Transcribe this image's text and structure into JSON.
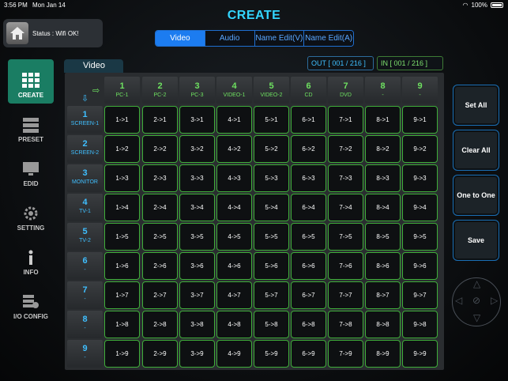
{
  "statusbar": {
    "time": "3:56 PM",
    "date": "Mon Jan 14",
    "battery": "100%"
  },
  "title": "CREATE",
  "status_panel": {
    "text": "Status : Wifi OK!"
  },
  "tabs": [
    "Video",
    "Audio",
    "Name Edit(V)",
    "Name Edit(A)"
  ],
  "sidebar": [
    {
      "label": "CREATE",
      "icon": "grid-icon"
    },
    {
      "label": "PRESET",
      "icon": "preset-icon"
    },
    {
      "label": "EDID",
      "icon": "monitor-icon"
    },
    {
      "label": "SETTING",
      "icon": "gear-icon"
    },
    {
      "label": "INFO",
      "icon": "info-icon"
    },
    {
      "label": "I/O CONFIG",
      "icon": "io-config-icon"
    }
  ],
  "section_label": "Video",
  "out_counter": "OUT [ 001 / 216 ]",
  "in_counter": "IN [ 001 / 216 ]",
  "columns": [
    {
      "num": "1",
      "name": "PC-1"
    },
    {
      "num": "2",
      "name": "PC-2"
    },
    {
      "num": "3",
      "name": "PC-3"
    },
    {
      "num": "4",
      "name": "VIDEO-1"
    },
    {
      "num": "5",
      "name": "VIDEO-2"
    },
    {
      "num": "6",
      "name": "CD"
    },
    {
      "num": "7",
      "name": "DVD"
    },
    {
      "num": "8",
      "name": "-"
    },
    {
      "num": "9",
      "name": "-"
    }
  ],
  "rows": [
    {
      "num": "1",
      "name": "SCREEN-1"
    },
    {
      "num": "2",
      "name": "SCREEN-2"
    },
    {
      "num": "3",
      "name": "MONITOR"
    },
    {
      "num": "4",
      "name": "TV-1"
    },
    {
      "num": "5",
      "name": "TV-2"
    },
    {
      "num": "6",
      "name": "-"
    },
    {
      "num": "7",
      "name": "-"
    },
    {
      "num": "8",
      "name": "-"
    },
    {
      "num": "9",
      "name": "-"
    }
  ],
  "buttons": [
    "Set All",
    "Clear All",
    "One to One",
    "Save"
  ],
  "colors": {
    "accent": "#33d6ff",
    "input_green": "#6ee060",
    "output_blue": "#3fbfff",
    "active_tab": "#1c7cf0",
    "active_side": "#1a7d63"
  }
}
